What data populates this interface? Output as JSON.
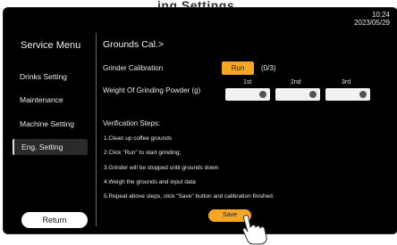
{
  "header": {
    "word": "ing Settings"
  },
  "clock": {
    "time": "10:24",
    "date": "2023/05/29"
  },
  "sidebar": {
    "title": "Service Menu",
    "items": [
      {
        "label": "Drinks Setting"
      },
      {
        "label": "Maintenance"
      },
      {
        "label": "Machine Setting"
      },
      {
        "label": "Eng. Setting"
      }
    ],
    "active_index": 3,
    "return_label": "Return"
  },
  "main": {
    "breadcrumb": "Grounds Cal.>",
    "grinder_calibration_label": "Grinder Calibration",
    "run_label": "Run",
    "run_count": "(0/3)",
    "weight_label": "Weight Of Grinding Powder (g)",
    "columns": [
      "1st",
      "2nd",
      "3rd"
    ],
    "weights": [
      "",
      "",
      ""
    ],
    "verification_title": "Verification Steps:",
    "steps": [
      "1.Clean up coffee grounds",
      "2.Click \"Run\" to start grinding;",
      "3.Grinder will be stopped until grounds down",
      "4.Weigh the grounds and input data",
      "5.Repeat above steps, click \"Save\" button and calibration finished."
    ],
    "save_label": "Save"
  },
  "colors": {
    "accent": "#f5a623",
    "background": "#000000",
    "text": "#e8e8e8"
  },
  "icons": {
    "field_icon": "keypad-icon",
    "pointer": "hand-pointer-icon"
  }
}
